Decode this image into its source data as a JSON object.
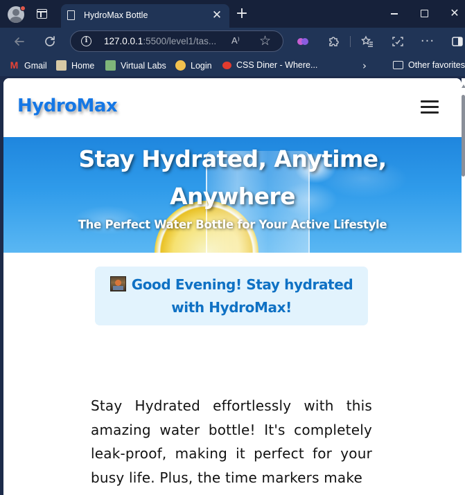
{
  "browser": {
    "tab_title": "HydroMax Bottle",
    "tab_close_glyph": "✕",
    "new_tab_glyph": "+",
    "window_close_glyph": "✕",
    "url_host": "127.0.0.1",
    "url_rest": ":5500/level1/tas...",
    "read_aloud_glyph": "A⁾",
    "more_glyph": "···",
    "bookmarks": [
      {
        "label": "Gmail",
        "icon": "gmail-icon"
      },
      {
        "label": "Home",
        "icon": "home-icon"
      },
      {
        "label": "Virtual Labs",
        "icon": "virtual-labs-icon"
      },
      {
        "label": "Login",
        "icon": "login-icon"
      },
      {
        "label": "CSS Diner - Where...",
        "icon": "css-diner-icon"
      }
    ],
    "other_favorites": "Other favorites"
  },
  "site": {
    "logo": "HydroMax",
    "hero_title": "Stay Hydrated, Anytime, Anywhere",
    "hero_subtitle": "The Perfect Water Bottle for Your Active Lifestyle",
    "greeting": "Good Evening! Stay hydrated with HydroMax!",
    "description": "Stay Hydrated effortlessly with this amazing water bottle! It's completely leak-proof, making it perfect for your busy life. Plus, the time markers make"
  },
  "colors": {
    "brand": "#1577e5",
    "greeting_bg": "#e2f3fd",
    "greeting_text": "#0f71c4",
    "chrome_dark": "#16213a",
    "chrome_mid": "#203456"
  }
}
